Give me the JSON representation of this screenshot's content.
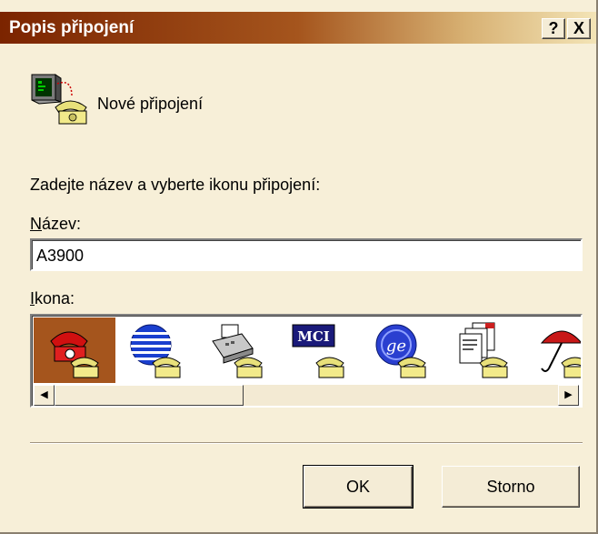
{
  "window": {
    "title": "Popis připojení",
    "help_label": "?",
    "close_label": "X"
  },
  "header": {
    "connection_name": "Nové připojení",
    "icon": "connection-phone-icon"
  },
  "form": {
    "prompt": "Zadejte název a vyberte ikonu připojení:",
    "name_label_accel": "N",
    "name_label_rest": "ázev:",
    "name_value": "A3900",
    "icon_label_accel": "I",
    "icon_label_rest": "kona:",
    "icons": [
      {
        "name": "red-phone-icon",
        "selected": true
      },
      {
        "name": "globe-icon",
        "selected": false
      },
      {
        "name": "fax-machine-icon",
        "selected": false
      },
      {
        "name": "mci-logo-icon",
        "selected": false
      },
      {
        "name": "ge-logo-icon",
        "selected": false
      },
      {
        "name": "documents-icon",
        "selected": false
      },
      {
        "name": "umbrella-icon",
        "selected": false
      }
    ]
  },
  "buttons": {
    "ok_label": "OK",
    "cancel_label": "Storno"
  },
  "colors": {
    "title_start": "#7b2400",
    "title_end": "#f3e4b6",
    "dialog_bg": "#f7efd8",
    "selection": "#a5551d"
  }
}
